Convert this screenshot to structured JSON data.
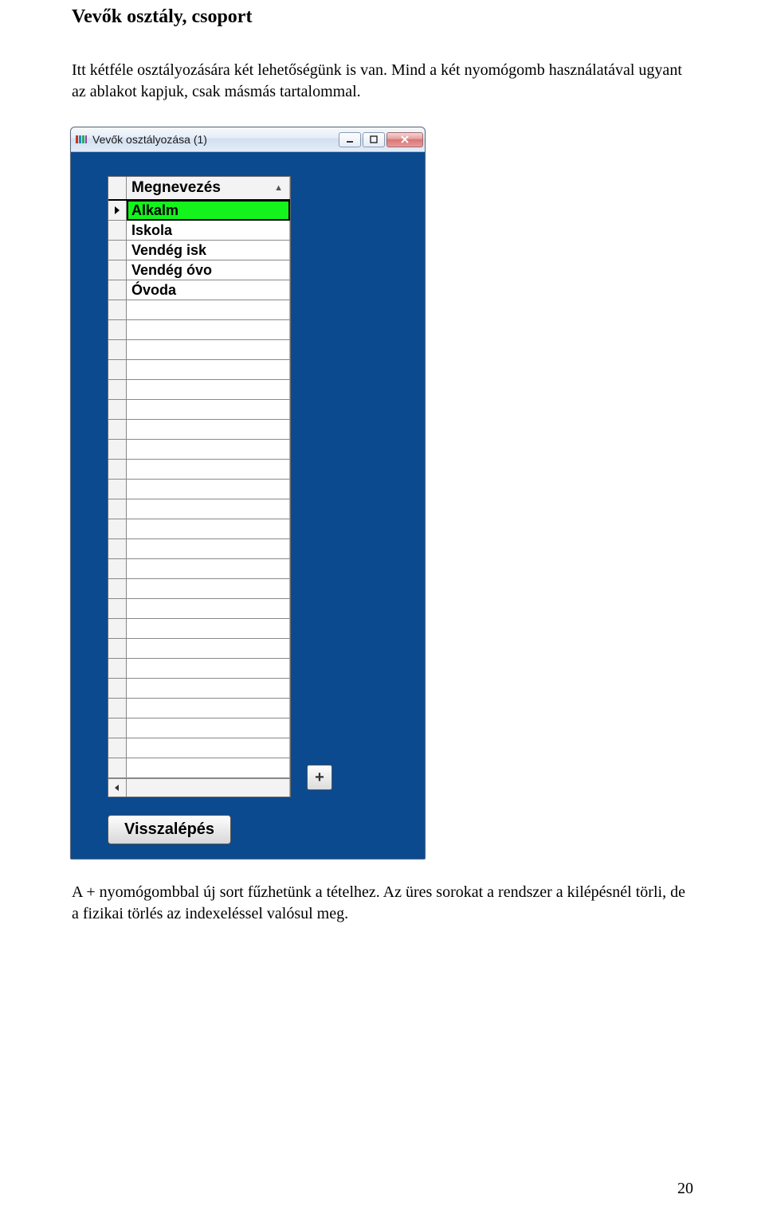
{
  "doc": {
    "heading": "Vevők osztály, csoport",
    "para1": "Itt kétféle osztályozására két lehetőségünk is van. Mind a két nyomógomb használatával ugyant az ablakot kapjuk, csak másmás tartalommal.",
    "para2": "A + nyomógombbal új sort fűzhetünk a tételhez. Az üres sorokat a rendszer a kilépésnél törli, de a fizikai törlés az indexeléssel valósul meg.",
    "page_number": "20"
  },
  "window": {
    "title": "Vevők osztályozása (1)",
    "column_header": "Megnevezés",
    "rows": [
      "Alkalm",
      "Iskola",
      "Vendég isk",
      "Vendég óvo",
      "Óvoda"
    ],
    "empty_row_count": 24,
    "back_button": "Visszalépés",
    "add_button_label": "+"
  }
}
